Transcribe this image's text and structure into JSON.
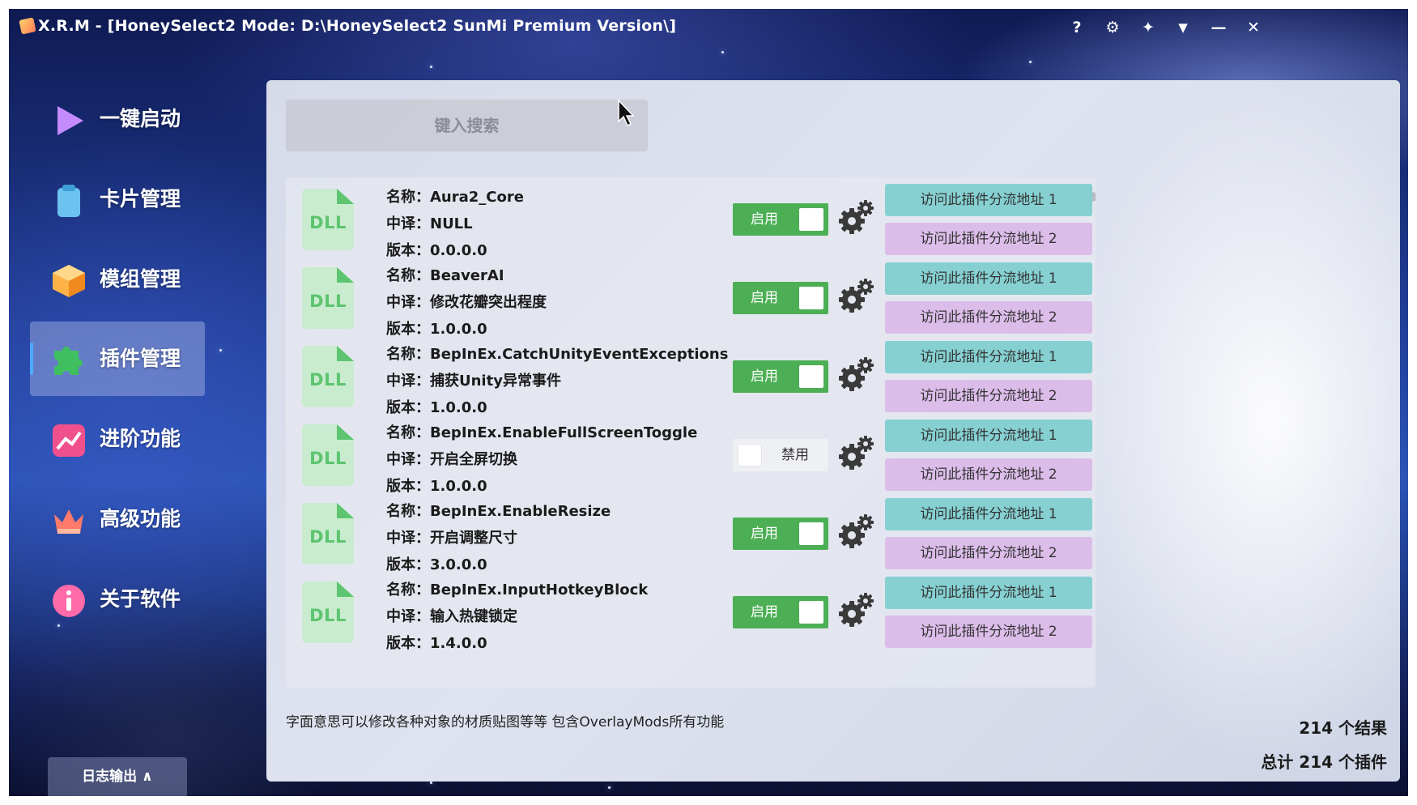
{
  "window": {
    "title": "X.R.M - [HoneySelect2 Mode: D:\\HoneySelect2 SunMi Premium Version\\]",
    "controls": {
      "help": "?",
      "settings": "⚙",
      "skin": "✦",
      "dropdown": "▼",
      "minimize": "—",
      "close": "✕"
    }
  },
  "sidebar": {
    "items": [
      {
        "label": "一键启动",
        "icon": "play-icon",
        "color": "#c48bff"
      },
      {
        "label": "卡片管理",
        "icon": "clipboard-icon",
        "color": "#6cc3f0"
      },
      {
        "label": "模组管理",
        "icon": "cube-icon",
        "color": "#ffb347"
      },
      {
        "label": "插件管理",
        "icon": "puzzle-icon",
        "color": "#3fbf60",
        "active": true
      },
      {
        "label": "进阶功能",
        "icon": "chart-up-icon",
        "color": "#f0508c"
      },
      {
        "label": "高级功能",
        "icon": "crown-icon",
        "color": "#ff7a6a"
      },
      {
        "label": "关于软件",
        "icon": "info-icon",
        "color": "#ff6aa8"
      }
    ],
    "log_button": "日志输出 ∧"
  },
  "search": {
    "placeholder": "键入搜索",
    "value": ""
  },
  "labels": {
    "name": "名称：",
    "translation": "中译：",
    "version": "版本："
  },
  "plugins": [
    {
      "name": "Aura2_Core",
      "translation": "NULL",
      "version": "0.0.0.0",
      "enabled": true,
      "toggle_label": "启用",
      "file_type": "DLL",
      "link1": "访问此插件分流地址 1",
      "link2": "访问此插件分流地址 2"
    },
    {
      "name": "BeaverAI",
      "translation": "修改花瓣突出程度",
      "version": "1.0.0.0",
      "enabled": true,
      "toggle_label": "启用",
      "file_type": "DLL",
      "link1": "访问此插件分流地址 1",
      "link2": "访问此插件分流地址 2"
    },
    {
      "name": "BepInEx.CatchUnityEventExceptions",
      "translation": "捕获Unity异常事件",
      "version": "1.0.0.0",
      "enabled": true,
      "toggle_label": "启用",
      "file_type": "DLL",
      "link1": "访问此插件分流地址 1",
      "link2": "访问此插件分流地址 2"
    },
    {
      "name": "BepInEx.EnableFullScreenToggle",
      "translation": "开启全屏切换",
      "version": "1.0.0.0",
      "enabled": false,
      "toggle_label": "禁用",
      "file_type": "DLL",
      "link1": "访问此插件分流地址 1",
      "link2": "访问此插件分流地址 2"
    },
    {
      "name": "BepInEx.EnableResize",
      "translation": "开启调整尺寸",
      "version": "3.0.0.0",
      "enabled": true,
      "toggle_label": "启用",
      "file_type": "DLL",
      "link1": "访问此插件分流地址 1",
      "link2": "访问此插件分流地址 2"
    },
    {
      "name": "BepInEx.InputHotkeyBlock",
      "translation": "输入热键锁定",
      "version": "1.4.0.0",
      "enabled": true,
      "toggle_label": "启用",
      "file_type": "DLL",
      "link1": "访问此插件分流地址 1",
      "link2": "访问此插件分流地址 2"
    }
  ],
  "description": "字面意思可以修改各种对象的材质贴图等等 包含OverlayMods所有功能",
  "results_text": "214 个结果",
  "total_text": "总计 214 个插件"
}
